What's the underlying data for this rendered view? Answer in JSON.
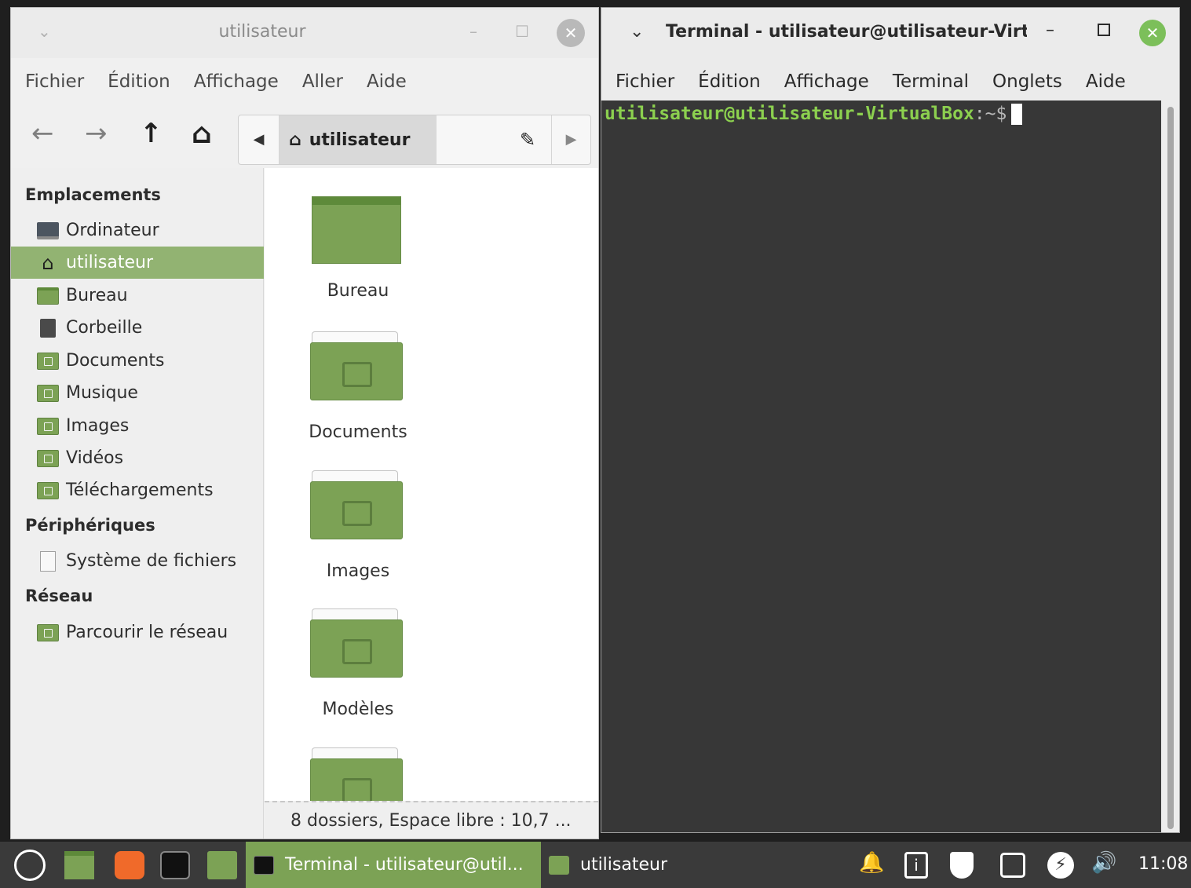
{
  "file_manager": {
    "title": "utilisateur",
    "menu": [
      "Fichier",
      "Édition",
      "Affichage",
      "Aller",
      "Aide"
    ],
    "path": "utilisateur",
    "sidebar": {
      "places_heading": "Emplacements",
      "places": [
        {
          "label": "Ordinateur",
          "icon": "computer-icon"
        },
        {
          "label": "utilisateur",
          "icon": "home-icon",
          "selected": true
        },
        {
          "label": "Bureau",
          "icon": "desktop-folder-icon"
        },
        {
          "label": "Corbeille",
          "icon": "trash-icon"
        },
        {
          "label": "Documents",
          "icon": "documents-folder-icon"
        },
        {
          "label": "Musique",
          "icon": "music-folder-icon"
        },
        {
          "label": "Images",
          "icon": "pictures-folder-icon"
        },
        {
          "label": "Vidéos",
          "icon": "videos-folder-icon"
        },
        {
          "label": "Téléchargements",
          "icon": "downloads-folder-icon"
        }
      ],
      "devices_heading": "Périphériques",
      "devices": [
        {
          "label": "Système de fichiers",
          "icon": "drive-icon"
        }
      ],
      "network_heading": "Réseau",
      "network": [
        {
          "label": "Parcourir le réseau",
          "icon": "network-folder-icon"
        }
      ]
    },
    "items": [
      {
        "label": "Bureau",
        "icon": "desktop-folder-icon"
      },
      {
        "label": "Documents",
        "icon": "documents-folder-icon"
      },
      {
        "label": "Images",
        "icon": "pictures-folder-icon"
      },
      {
        "label": "Modèles",
        "icon": "templates-folder-icon"
      },
      {
        "label": "",
        "icon": "music-folder-icon"
      }
    ],
    "status": "8 dossiers, Espace libre : 10,7 ..."
  },
  "terminal": {
    "title": "Terminal - utilisateur@utilisateur-Virtu",
    "menu": [
      "Fichier",
      "Édition",
      "Affichage",
      "Terminal",
      "Onglets",
      "Aide"
    ],
    "prompt_user": "utilisateur@utilisateur-VirtualBox",
    "prompt_path": ":~$"
  },
  "taskbar": {
    "windows": [
      {
        "label": "Terminal - utilisateur@util...",
        "active": true
      },
      {
        "label": "utilisateur",
        "active": false
      }
    ],
    "clock": "11:08"
  },
  "colors": {
    "accent": "#7ca255",
    "selection": "#92b372",
    "terminal_bg": "#373737",
    "prompt_green": "#8cd04f"
  }
}
